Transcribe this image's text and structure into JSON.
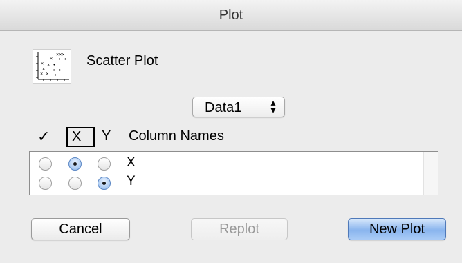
{
  "window": {
    "title": "Plot"
  },
  "plot_type": {
    "name": "Scatter Plot",
    "icon": "scatter-plot-icon"
  },
  "dataset_popup": {
    "selected": "Data1"
  },
  "column_header": {
    "check": "✓",
    "x": "X",
    "y": "Y",
    "names": "Column Names"
  },
  "columns": [
    {
      "name": "X",
      "selection": "x"
    },
    {
      "name": "Y",
      "selection": "y"
    }
  ],
  "buttons": {
    "cancel": "Cancel",
    "replot": "Replot",
    "new_plot": "New Plot"
  },
  "colors": {
    "default_button": "#8ab5ee",
    "radio_selected": "#a9c9f1"
  }
}
